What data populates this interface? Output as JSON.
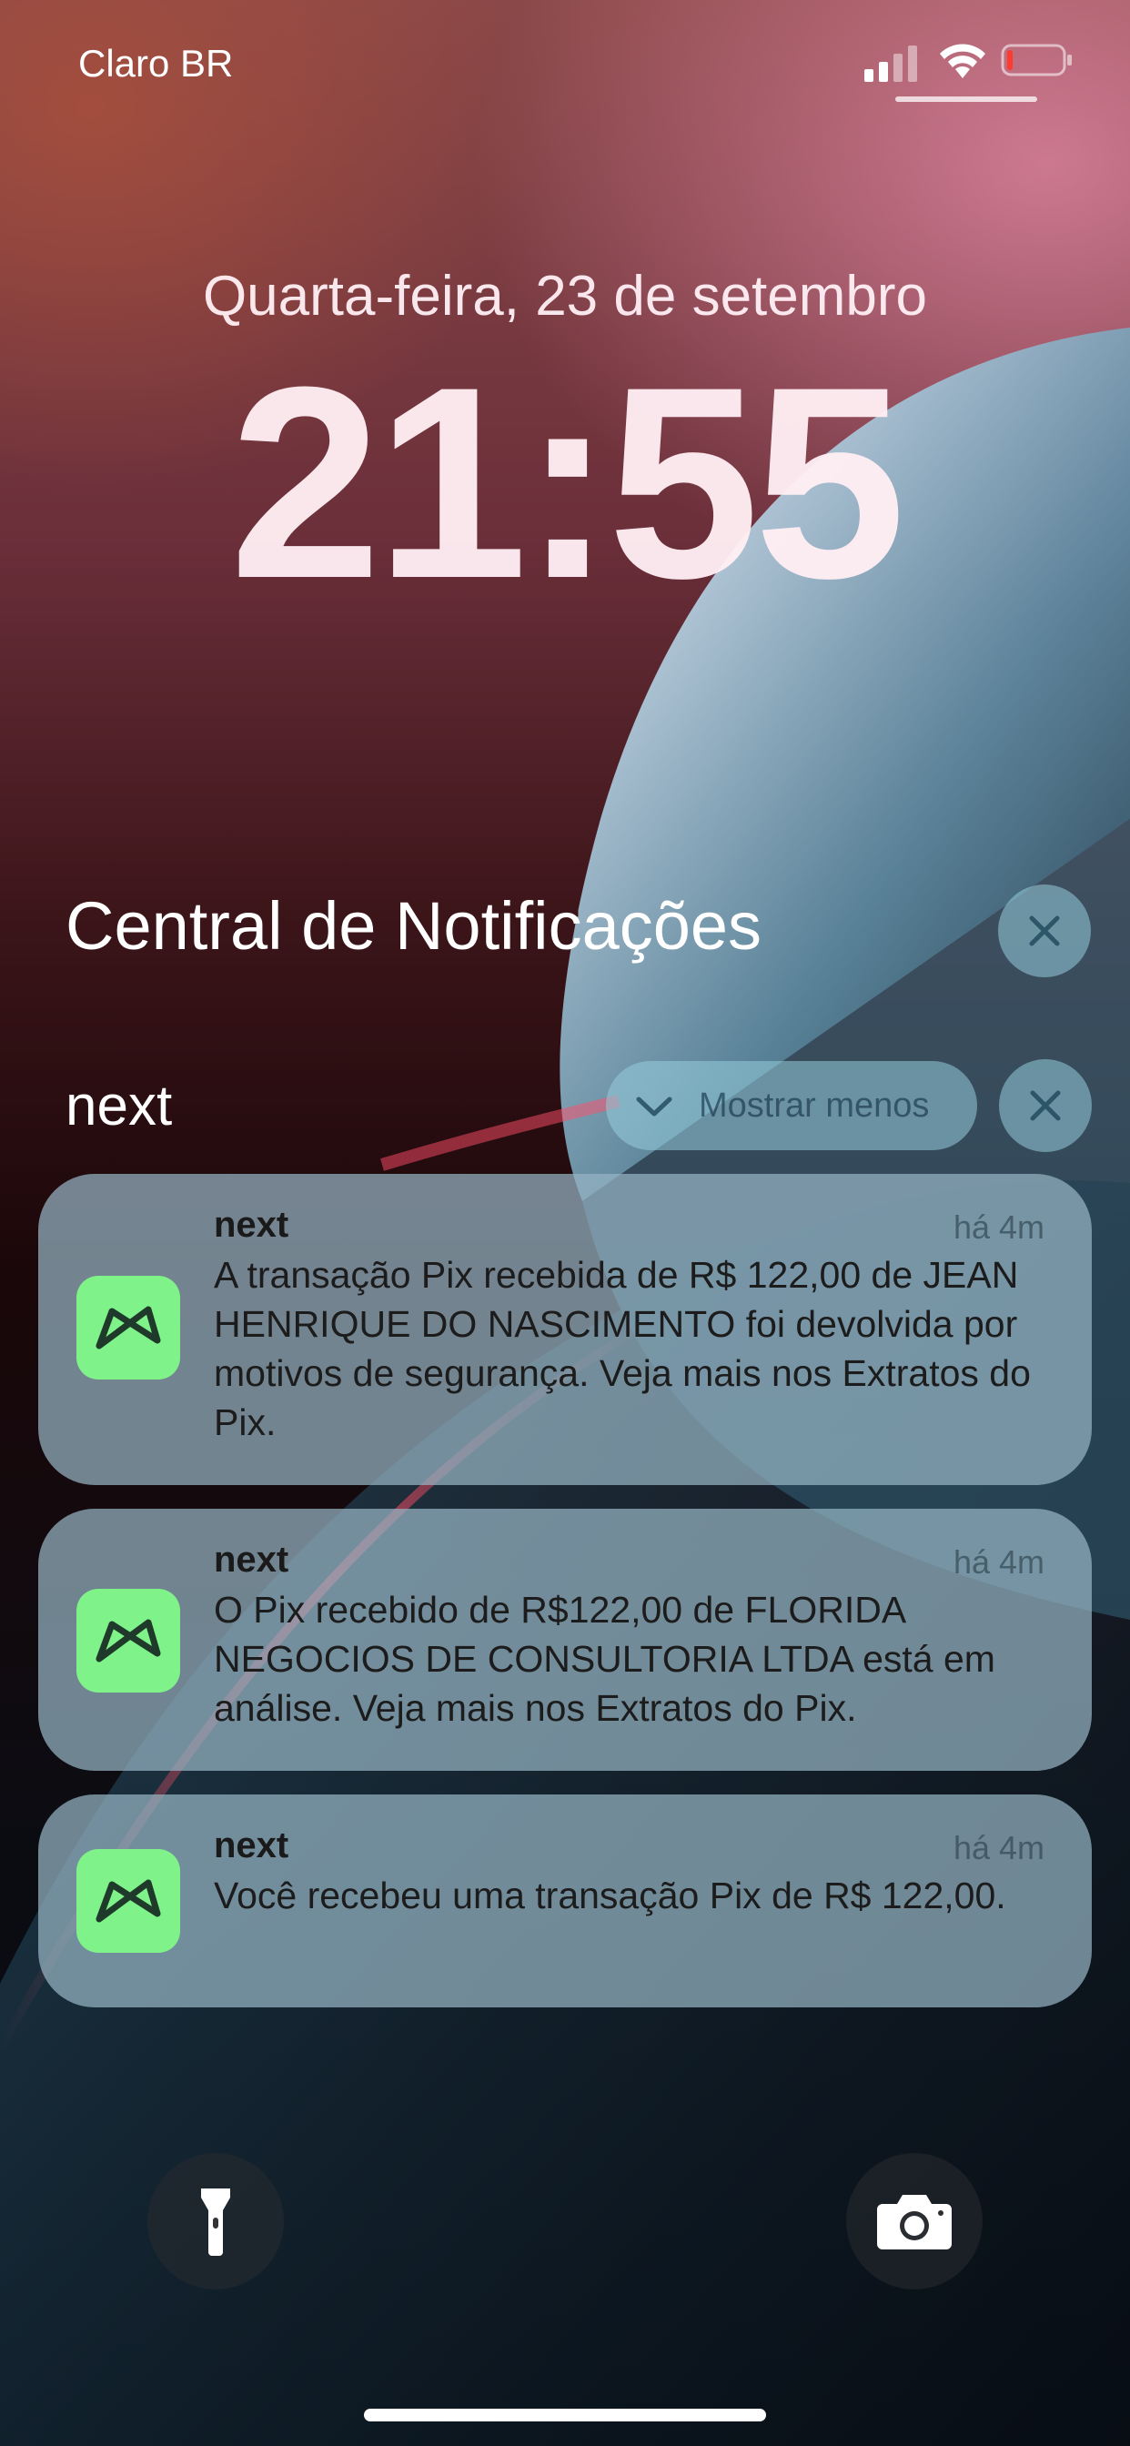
{
  "status_bar": {
    "carrier": "Claro BR",
    "signal_icon": "cellular-signal-icon",
    "wifi_icon": "wifi-icon",
    "battery_icon": "battery-low-icon",
    "battery_level": 0.08,
    "battery_color": "#ff3b30"
  },
  "lock_screen": {
    "date": "Quarta-feira, 23 de setembro",
    "time": "21:55"
  },
  "notification_center": {
    "title": "Central de Notificações",
    "close_icon": "close-icon",
    "group": {
      "name": "next",
      "show_less_label": "Mostrar menos",
      "chevron_icon": "chevron-down-icon",
      "close_icon": "close-icon",
      "accent_color": "#7ff28a",
      "notifications": [
        {
          "app": "next",
          "time": "há 4m",
          "body": "A transação Pix recebida de R$ 122,00 de JEAN HENRIQUE DO NASCIMENTO foi devolvida por motivos de segurança. Veja mais nos Extratos do Pix."
        },
        {
          "app": "next",
          "time": "há 4m",
          "body": "O Pix recebido de R$122,00 de FLORIDA NEGOCIOS DE CONSULTORIA LTDA está em análise. Veja mais nos Extratos do Pix."
        },
        {
          "app": "next",
          "time": "há 4m",
          "body": "Você recebeu uma transação Pix de R$ 122,00."
        }
      ]
    }
  },
  "quick_actions": {
    "flashlight_icon": "flashlight-icon",
    "camera_icon": "camera-icon"
  }
}
